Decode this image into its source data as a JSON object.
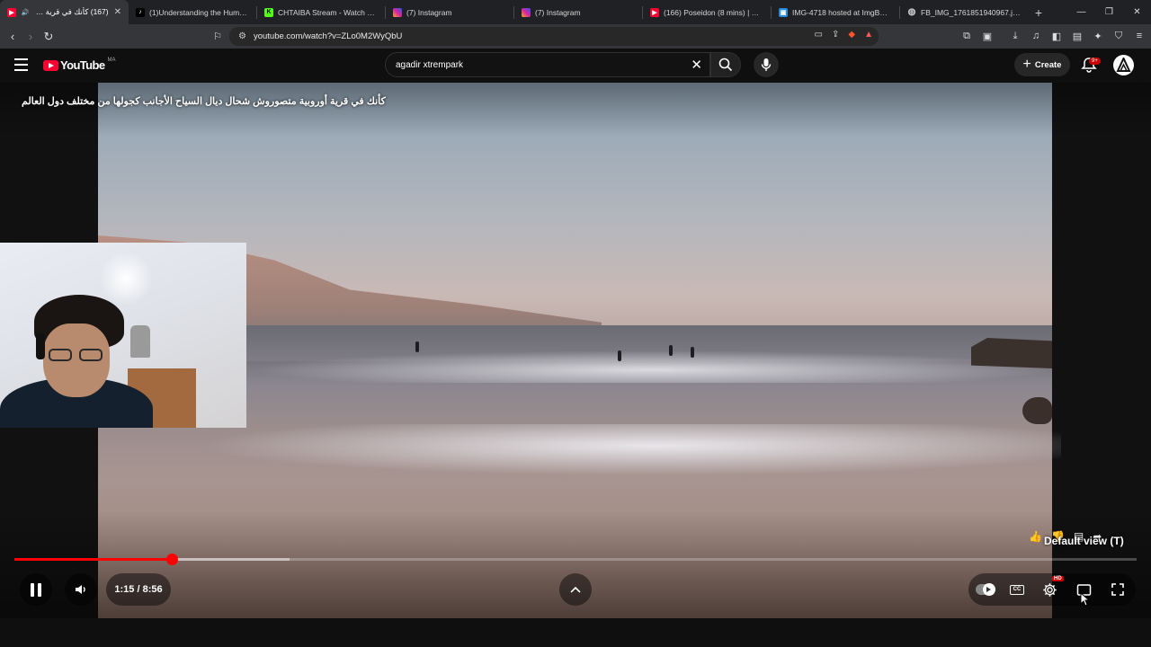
{
  "browser": {
    "tabs": [
      {
        "title": "(167) كأنك في قرية أوروبية",
        "favicon": "youtube-icon",
        "active": true
      },
      {
        "title": "(1)Understanding the Humor i",
        "favicon": "tiktok-icon"
      },
      {
        "title": "CHTAIBA Stream - Watch Live o",
        "favicon": "kick-icon"
      },
      {
        "title": "(7) Instagram",
        "favicon": "instagram-icon"
      },
      {
        "title": "(7) Instagram",
        "favicon": "instagram-icon"
      },
      {
        "title": "(166) Poseidon (8 mins) | God o",
        "favicon": "youtube-icon"
      },
      {
        "title": "IMG-4718 hosted at ImgBB —",
        "favicon": "imgbb-icon"
      },
      {
        "title": "FB_IMG_1761851940967.jpg (",
        "favicon": "globe-icon"
      }
    ],
    "new_tab": "+",
    "url": "youtube.com/watch?v=ZLo0M2WyQbU"
  },
  "youtube": {
    "logo_text": "YouTube",
    "country_code": "MA",
    "search_query": "agadir xtrempark",
    "create_label": "Create",
    "notification_count": "9+"
  },
  "player": {
    "video_title": "كأنك في قرية أوروبية متصوروش شحال ديال السياح الأجانب كجولها من مختلف دول العالم",
    "time_display": "1:15 / 8:56",
    "progress_fraction": 0.1399,
    "loaded_fraction": 0.245,
    "default_view_label": "Default view",
    "default_view_shortcut": "T",
    "quality_badge": "HD"
  },
  "colors": {
    "accent": "#ff0000",
    "youtube_red": "#ff0033",
    "badge_red": "#cc0000"
  }
}
